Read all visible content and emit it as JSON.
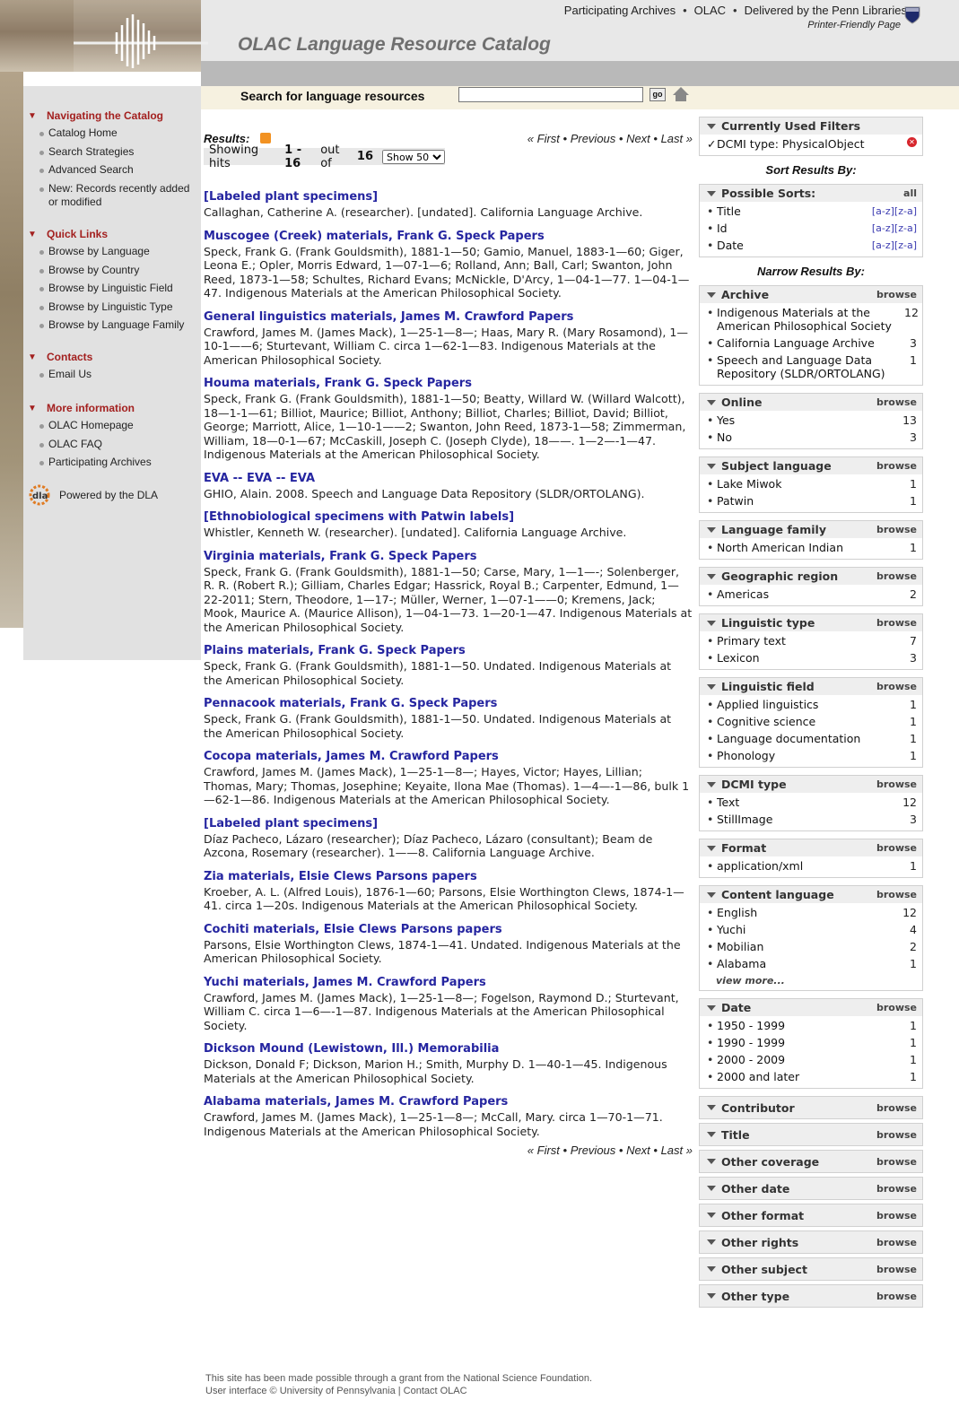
{
  "header": {
    "top_links": [
      "Participating Archives",
      "OLAC",
      "Delivered by the Penn Libraries"
    ],
    "printer_link": "Printer-Friendly Page",
    "site_title": "OLAC Language Resource Catalog"
  },
  "search": {
    "label": "Search for language resources",
    "value": "",
    "go_label": "go"
  },
  "nav": {
    "sections": [
      {
        "title": "Navigating the Catalog",
        "items": [
          "Catalog Home",
          "Search Strategies",
          "Advanced Search",
          "New: Records recently added or modified"
        ]
      },
      {
        "title": "Quick Links",
        "items": [
          "Browse by Language",
          "Browse by Country",
          "Browse by Linguistic Field",
          "Browse by Linguistic Type",
          "Browse by Language Family"
        ]
      },
      {
        "title": "Contacts",
        "items": [
          "Email Us"
        ]
      },
      {
        "title": "More information",
        "items": [
          "OLAC Homepage",
          "OLAC FAQ",
          "Participating Archives"
        ]
      }
    ],
    "powered_by": "Powered by the DLA"
  },
  "results": {
    "label": "Results:",
    "pager": {
      "first": "« First",
      "previous": "Previous",
      "next": "Next",
      "last": "Last »",
      "sep": " • "
    },
    "hits_prefix": "Showing hits ",
    "hits_range": "1 - 16",
    "hits_mid": " out of ",
    "hits_total": "16",
    "show_option": "Show 50",
    "items": [
      {
        "title": "[Labeled plant specimens]",
        "desc": "Callaghan, Catherine A. (researcher). [undated]. California Language Archive."
      },
      {
        "title": "Muscogee (Creek) materials, Frank G. Speck Papers",
        "desc": "Speck, Frank G. (Frank Gouldsmith), 1881-1—50; Gamio, Manuel, 1883-1—60; Giger, Leona E.; Opler, Morris Edward, 1—07-1—6; Rolland, Ann; Ball, Carl; Swanton, John Reed, 1873-1—58; Schultes, Richard Evans; McNickle, D'Arcy, 1—04-1—77. 1—04-1—47. Indigenous Materials at the American Philosophical Society."
      },
      {
        "title": "General linguistics materials, James M. Crawford Papers",
        "desc": "Crawford, James M. (James Mack), 1—25-1—8—; Haas, Mary R. (Mary Rosamond), 1—10-1——6; Sturtevant, William C. circa 1—62-1—83. Indigenous Materials at the American Philosophical Society."
      },
      {
        "title": "Houma materials, Frank G. Speck Papers",
        "desc": "Speck, Frank G. (Frank Gouldsmith), 1881-1—50; Beatty, Willard W. (Willard Walcott), 18—1-1—61; Billiot, Maurice; Billiot, Anthony; Billiot, Charles; Billiot, David; Billiot, George; Marriott, Alice, 1—10-1——2; Swanton, John Reed, 1873-1—58; Zimmerman, William, 18—0-1—67; McCaskill, Joseph C. (Joseph Clyde), 18——. 1—2—-1—47. Indigenous Materials at the American Philosophical Society."
      },
      {
        "title": "EVA -- EVA -- EVA",
        "desc": "GHIO, Alain. 2008. Speech and Language Data Repository (SLDR/ORTOLANG)."
      },
      {
        "title": "[Ethnobiological specimens with Patwin labels]",
        "desc": "Whistler, Kenneth W. (researcher). [undated]. California Language Archive."
      },
      {
        "title": "Virginia materials, Frank G. Speck Papers",
        "desc": "Speck, Frank G. (Frank Gouldsmith), 1881-1—50; Carse, Mary, 1—1—-; Solenberger, R. R. (Robert R.); Gilliam, Charles Edgar; Hassrick, Royal B.; Carpenter, Edmund, 1—22-2011; Stern, Theodore, 1—17-; Müller, Werner, 1—07-1——0; Kremens, Jack; Mook, Maurice A. (Maurice Allison), 1—04-1—73. 1—20-1—47. Indigenous Materials at the American Philosophical Society."
      },
      {
        "title": "Plains materials, Frank G. Speck Papers",
        "desc": "Speck, Frank G. (Frank Gouldsmith), 1881-1—50. Undated. Indigenous Materials at the American Philosophical Society."
      },
      {
        "title": "Pennacook materials, Frank G. Speck Papers",
        "desc": "Speck, Frank G. (Frank Gouldsmith), 1881-1—50. Undated. Indigenous Materials at the American Philosophical Society."
      },
      {
        "title": "Cocopa materials, James M. Crawford Papers",
        "desc": "Crawford, James M. (James Mack), 1—25-1—8—; Hayes, Victor; Hayes, Lillian; Thomas, Mary; Thomas, Josephine; Keyaite, Ilona Mae (Thomas). 1—4—-1—86, bulk 1—62-1—86. Indigenous Materials at the American Philosophical Society."
      },
      {
        "title": "[Labeled plant specimens]",
        "desc": "Díaz Pacheco, Lázaro (researcher); Díaz Pacheco, Lázaro (consultant); Beam de Azcona, Rosemary (researcher). 1——8. California Language Archive."
      },
      {
        "title": "Zia materials, Elsie Clews Parsons papers",
        "desc": "Kroeber, A. L. (Alfred Louis), 1876-1—60; Parsons, Elsie Worthington Clews, 1874-1—41. circa 1—20s. Indigenous Materials at the American Philosophical Society."
      },
      {
        "title": "Cochiti materials, Elsie Clews Parsons papers",
        "desc": "Parsons, Elsie Worthington Clews, 1874-1—41. Undated. Indigenous Materials at the American Philosophical Society."
      },
      {
        "title": "Yuchi materials, James M. Crawford Papers",
        "desc": "Crawford, James M. (James Mack), 1—25-1—8—; Fogelson, Raymond D.; Sturtevant, William C. circa 1—6—-1—87. Indigenous Materials at the American Philosophical Society."
      },
      {
        "title": "Dickson Mound (Lewistown, Ill.) Memorabilia",
        "desc": "Dickson, Donald F; Dickson, Marion H.; Smith, Murphy D. 1—40-1—45. Indigenous Materials at the American Philosophical Society."
      },
      {
        "title": "Alabama materials, James M. Crawford Papers",
        "desc": "Crawford, James M. (James Mack), 1—25-1—8—; McCall, Mary. circa 1—70-1—71. Indigenous Materials at the American Philosophical Society."
      }
    ]
  },
  "sidebar": {
    "filters": {
      "title": "Currently Used Filters",
      "items": [
        {
          "label": "DCMI type: PhysicalObject"
        }
      ]
    },
    "sort_heading": "Sort Results By:",
    "sorts": {
      "title": "Possible Sorts:",
      "all": "all",
      "items": [
        {
          "label": "Title",
          "order": "[a-z][z-a]"
        },
        {
          "label": "Id",
          "order": "[a-z][z-a]"
        },
        {
          "label": "Date",
          "order": "[a-z][z-a]"
        }
      ]
    },
    "narrow_heading": "Narrow Results By:",
    "browse_label": "browse",
    "facets": [
      {
        "title": "Archive",
        "items": [
          {
            "label": "Indigenous Materials at the American Philosophical Society",
            "count": "12"
          },
          {
            "label": "California Language Archive",
            "count": "3"
          },
          {
            "label": "Speech and Language Data Repository (SLDR/ORTOLANG)",
            "count": "1"
          }
        ]
      },
      {
        "title": "Online",
        "items": [
          {
            "label": "Yes",
            "count": "13"
          },
          {
            "label": "No",
            "count": "3"
          }
        ]
      },
      {
        "title": "Subject language",
        "items": [
          {
            "label": "Lake Miwok",
            "count": "1"
          },
          {
            "label": "Patwin",
            "count": "1"
          }
        ]
      },
      {
        "title": "Language family",
        "items": [
          {
            "label": "North American Indian",
            "count": "1"
          }
        ]
      },
      {
        "title": "Geographic region",
        "items": [
          {
            "label": "Americas",
            "count": "2"
          }
        ]
      },
      {
        "title": "Linguistic type",
        "items": [
          {
            "label": "Primary text",
            "count": "7"
          },
          {
            "label": "Lexicon",
            "count": "3"
          }
        ]
      },
      {
        "title": "Linguistic field",
        "items": [
          {
            "label": "Applied linguistics",
            "count": "1"
          },
          {
            "label": "Cognitive science",
            "count": "1"
          },
          {
            "label": "Language documentation",
            "count": "1"
          },
          {
            "label": "Phonology",
            "count": "1"
          }
        ]
      },
      {
        "title": "DCMI type",
        "items": [
          {
            "label": "Text",
            "count": "12"
          },
          {
            "label": "StillImage",
            "count": "3"
          }
        ]
      },
      {
        "title": "Format",
        "items": [
          {
            "label": "application/xml",
            "count": "1"
          }
        ]
      },
      {
        "title": "Content language",
        "items": [
          {
            "label": "English",
            "count": "12"
          },
          {
            "label": "Yuchi",
            "count": "4"
          },
          {
            "label": "Mobilian",
            "count": "2"
          },
          {
            "label": "Alabama",
            "count": "1"
          }
        ],
        "more": "view more..."
      },
      {
        "title": "Date",
        "items": [
          {
            "label": "1950 - 1999",
            "count": "1"
          },
          {
            "label": "1990 - 1999",
            "count": "1"
          },
          {
            "label": "2000 - 2009",
            "count": "1"
          },
          {
            "label": "2000 and later",
            "count": "1"
          }
        ]
      }
    ],
    "collapsed": [
      "Contributor",
      "Title",
      "Other coverage",
      "Other date",
      "Other format",
      "Other rights",
      "Other subject",
      "Other type"
    ]
  },
  "footer": {
    "line1": "This site has been made possible through a grant from the National Science Foundation.",
    "line2": "User interface © University of Pennsylvania | Contact OLAC"
  }
}
